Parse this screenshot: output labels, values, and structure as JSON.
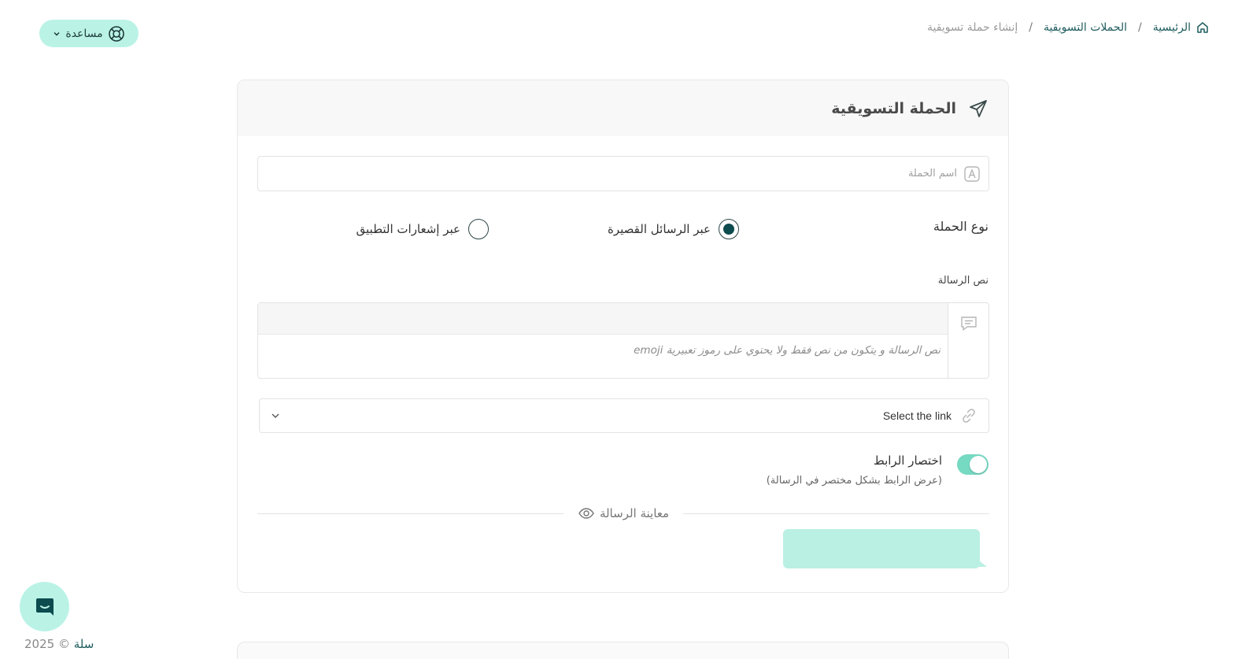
{
  "breadcrumb": {
    "home": "الرئيسية",
    "campaigns": "الحملات التسويقية",
    "current": "إنشاء حملة تسويقية",
    "separator": "/"
  },
  "help": {
    "label": "مساعدة"
  },
  "card": {
    "title": "الحملة التسويقية",
    "name_placeholder": "اسم الحملة",
    "type_label": "نوع الحملة",
    "radio_sms": "عبر الرسائل القصيرة",
    "radio_push": "عبر إشعارات التطبيق",
    "selected_type": "sms",
    "message_label": "نص الرسالة",
    "message_placeholder": "نص الرسالة و يتكون من نص فقط ولا يحتوي على رموز تعبيرية emoji",
    "link_select": "Select the link",
    "shorten_title": "اختصار الرابط",
    "shorten_sub": "(عرض الرابط بشكل مختصر في الرسالة)",
    "shorten_enabled": true,
    "preview_label": "معاينة الرسالة"
  },
  "footer": {
    "year": "2025 ©",
    "brand": "سلة"
  },
  "colors": {
    "accent": "#baf3e6",
    "toggle_on": "#76d9c2",
    "radio_fill": "#0c4b4e",
    "link_text": "#1e5c5e"
  },
  "icons": {
    "home": "home-icon",
    "help": "lifebuoy-icon",
    "title": "paper-plane-icon",
    "name": "letter-a-icon",
    "message": "chat-icon",
    "link": "link-icon",
    "preview": "eye-icon",
    "launcher": "chat-bubble-icon"
  }
}
